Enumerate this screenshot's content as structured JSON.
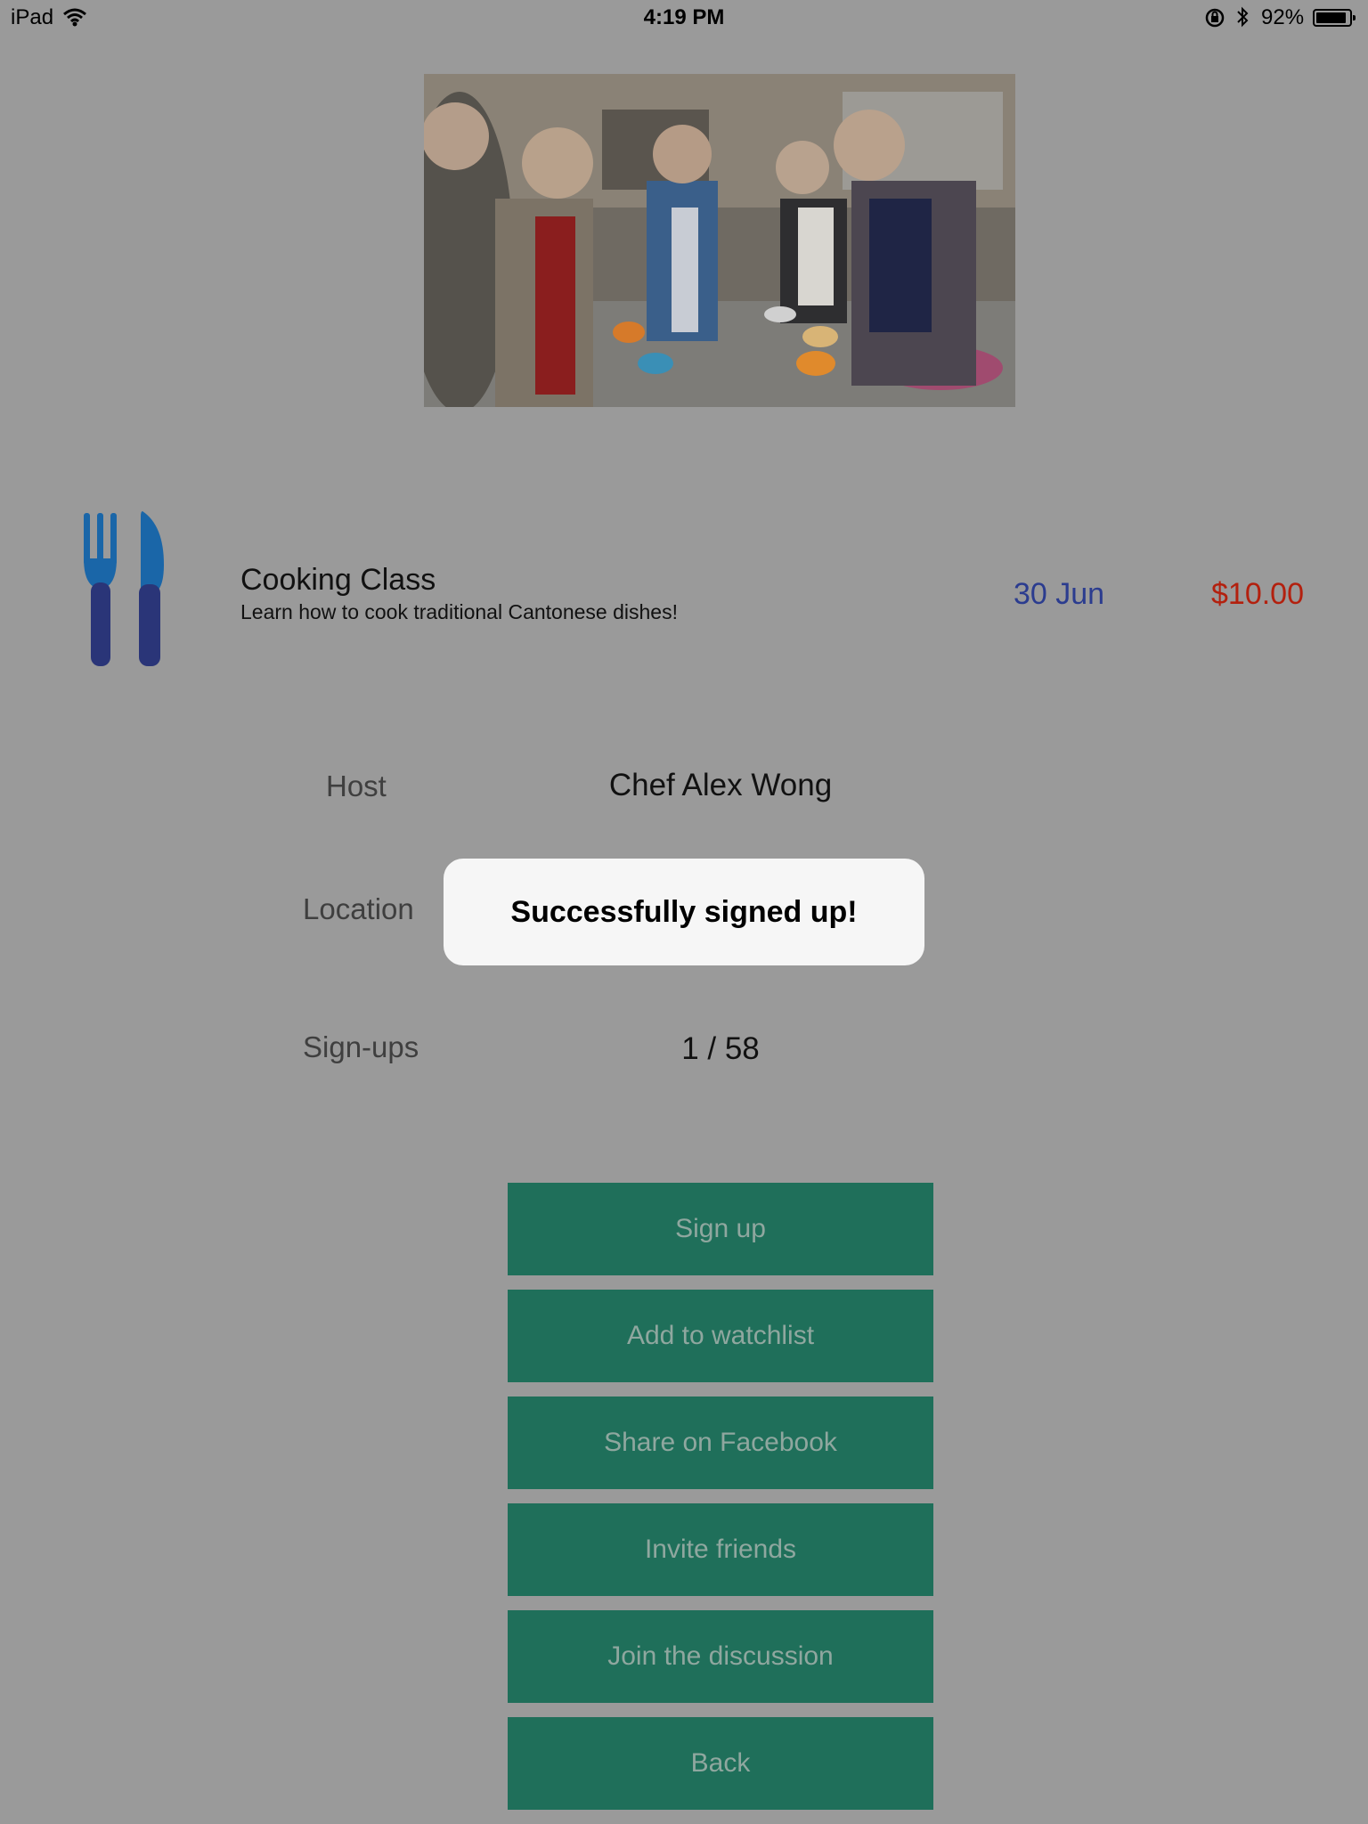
{
  "status_bar": {
    "device": "iPad",
    "time": "4:19 PM",
    "battery": "92%",
    "battery_level": 0.92
  },
  "event": {
    "icon": "fork-knife-icon",
    "title": "Cooking Class",
    "subtitle": "Learn how to cook traditional Cantonese dishes!",
    "date": "30 Jun",
    "price": "$10.00"
  },
  "details": {
    "host_label": "Host",
    "host_value": "Chef Alex Wong",
    "location_label": "Location",
    "signups_label": "Sign-ups",
    "signups_value": "1 / 58"
  },
  "toast": {
    "message": "Successfully signed up!"
  },
  "buttons": {
    "sign_up": "Sign up",
    "watchlist": "Add to watchlist",
    "facebook": "Share on Facebook",
    "invite": "Invite friends",
    "discussion": "Join the discussion",
    "back": "Back"
  },
  "colors": {
    "background": "#9a9a9a",
    "button": "#1f6f5a",
    "button_text": "#8fa79f",
    "date": "#2b3c8f",
    "price": "#b3200e",
    "toast": "#f6f6f6"
  }
}
